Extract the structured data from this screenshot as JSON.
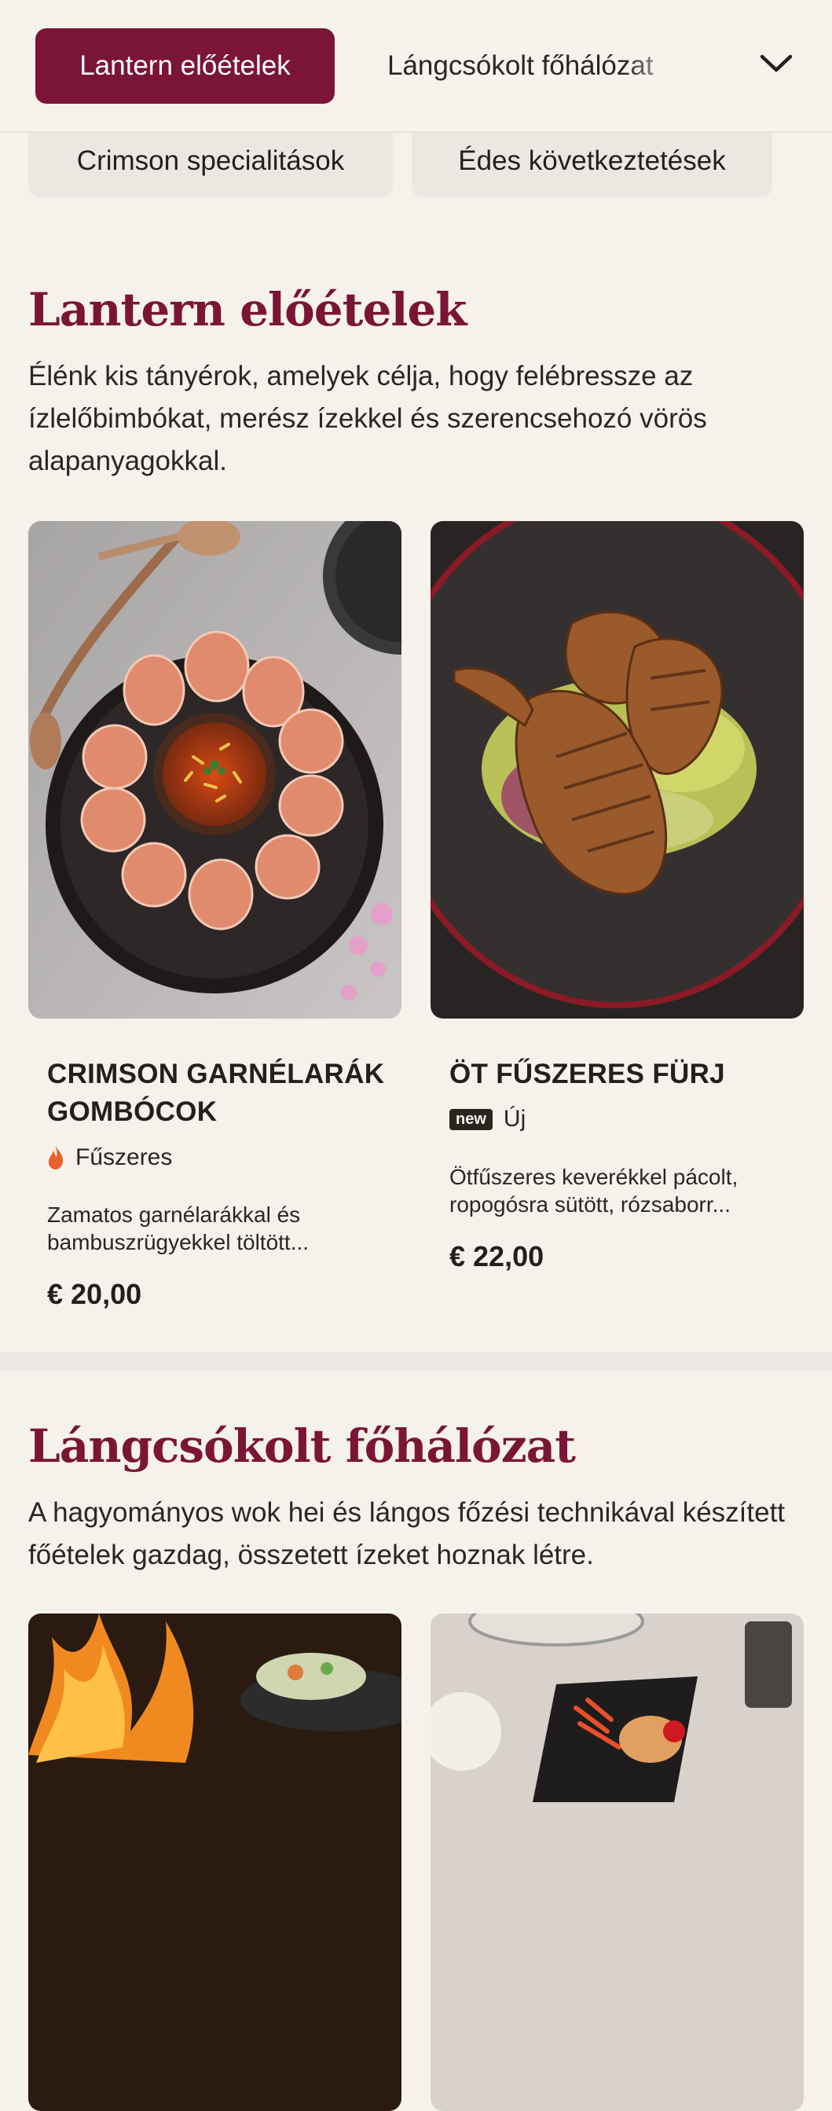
{
  "nav": {
    "active_category": "Lantern előételek",
    "next_category": "Lángcsókolt főhálózat",
    "chips": [
      "Crimson specialitások",
      "Édes következtetések"
    ],
    "dropdown_icon": "chevron-down-icon"
  },
  "sections": [
    {
      "title": "Lantern előételek",
      "description": "Élénk kis tányérok, amelyek célja, hogy felébressze az ízlelőbimbókat, merész ízekkel és szerencsehozó vörös alapanyagokkal.",
      "items": [
        {
          "name": "CRIMSON GARNÉLARÁK GOMBÓCOK",
          "tag": "Fűszeres",
          "tag_icon": "flame-icon",
          "description": "Zamatos garnélarákkal és bambuszrügyekkel töltött...",
          "price": "€ 20,00"
        },
        {
          "name": "ÖT FŰSZERES FÜRJ",
          "badge": "new",
          "tag": "Új",
          "description": "Ötfűszeres keverékkel pácolt, ropogósra sütött, rózsaborr...",
          "price": "€ 22,00"
        }
      ]
    },
    {
      "title": "Lángcsókolt főhálózat",
      "description": "A hagyományos wok hei és lángos főzési technikával készített főételek gazdag, összetett ízeket hoznak létre."
    }
  ],
  "colors": {
    "accent": "#7a1537",
    "background": "#f5f1eb",
    "chip": "#ede7e2",
    "flame": "#e8602a"
  }
}
